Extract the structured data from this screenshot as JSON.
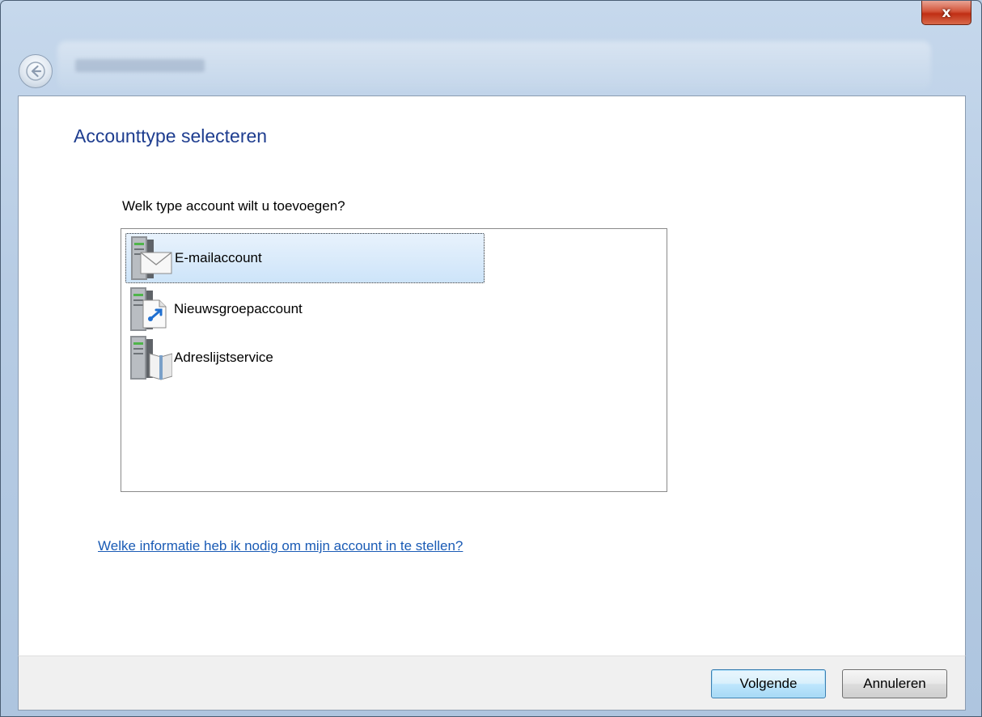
{
  "window": {
    "close_glyph": "x",
    "back_icon": "back-arrow-icon"
  },
  "page": {
    "title": "Accounttype selecteren",
    "prompt": "Welk type account wilt u toevoegen?"
  },
  "account_types": [
    {
      "label": "E-mailaccount",
      "icon": "email-server-icon",
      "selected": true
    },
    {
      "label": "Nieuwsgroepaccount",
      "icon": "newsgroup-server-icon",
      "selected": false
    },
    {
      "label": "Adreslijstservice",
      "icon": "directory-server-icon",
      "selected": false
    }
  ],
  "help_link": "Welke informatie heb ik nodig om mijn account in te stellen?",
  "buttons": {
    "next": "Volgende",
    "cancel": "Annuleren"
  },
  "colors": {
    "title": "#1e3d8f",
    "link": "#1a5bb5",
    "selection": "#cde4f9",
    "close": "#c02e14"
  }
}
